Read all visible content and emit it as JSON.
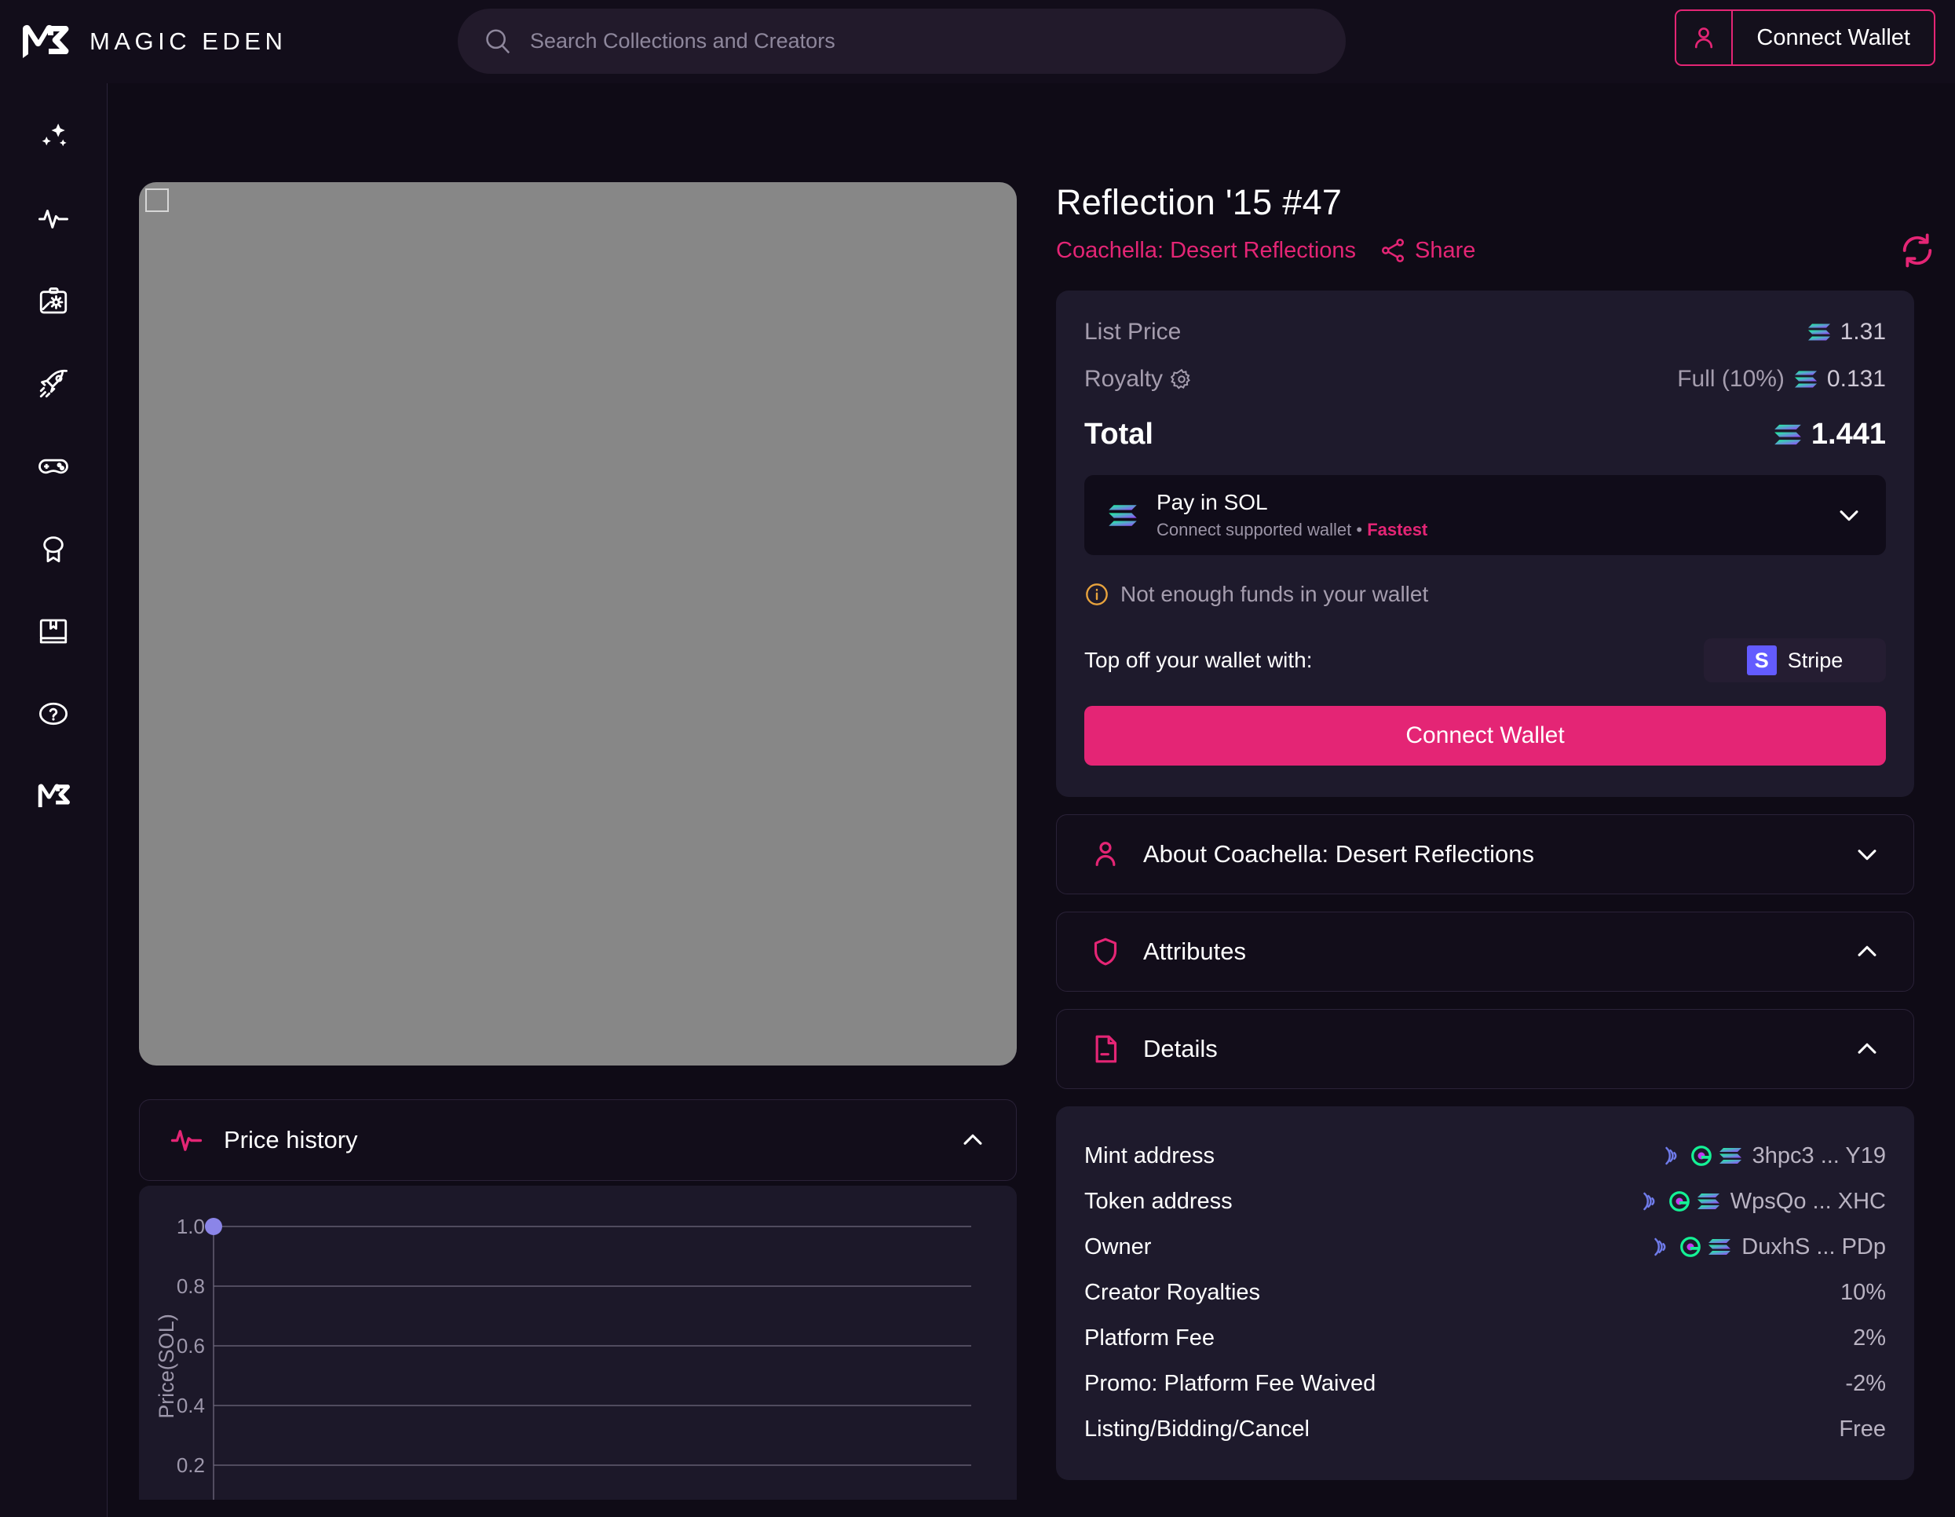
{
  "header": {
    "brand": "MAGIC EDEN",
    "brand_logo_icon": "magic-eden-logo",
    "search_placeholder": "Search Collections and Creators",
    "search_value": "",
    "search_icon": "search-icon",
    "connect_wallet_label": "Connect Wallet",
    "connect_wallet_icon": "user-icon"
  },
  "sidebar": {
    "items": [
      {
        "name": "sidebar-item-discover",
        "icon": "sparkles-icon"
      },
      {
        "name": "sidebar-item-activity",
        "icon": "activity-pulse-icon"
      },
      {
        "name": "sidebar-item-launchpad",
        "icon": "clipboard-icon"
      },
      {
        "name": "sidebar-item-rocket",
        "icon": "rocket-icon"
      },
      {
        "name": "sidebar-item-games",
        "icon": "gamepad-icon"
      },
      {
        "name": "sidebar-item-rewards",
        "icon": "award-badge-icon"
      },
      {
        "name": "sidebar-item-learn",
        "icon": "bookmark-book-icon"
      },
      {
        "name": "sidebar-item-help",
        "icon": "help-circle-icon"
      },
      {
        "name": "sidebar-item-me",
        "icon": "magic-eden-mark-icon"
      }
    ]
  },
  "nft": {
    "title": "Reflection '15 #47",
    "collection": "Coachella: Desert Reflections",
    "share_label": "Share",
    "share_icon": "share-nodes-icon",
    "refresh_icon": "refresh-icon",
    "image_alt": "nft-artwork-placeholder"
  },
  "price": {
    "list_price_label": "List Price",
    "list_price_value": "1.31",
    "royalty_label": "Royalty",
    "royalty_gear_icon": "gear-icon",
    "royalty_note": "Full (10%)",
    "royalty_value": "0.131",
    "total_label": "Total",
    "total_value": "1.441",
    "currency_icon": "solana-icon"
  },
  "payment": {
    "method_title": "Pay in SOL",
    "method_sub_prefix": "Connect supported wallet",
    "method_sub_sep": "•",
    "method_sub_badge": "Fastest",
    "method_icon": "solana-icon",
    "chevron_icon": "chevron-down-icon",
    "warning_text": "Not enough funds in your wallet",
    "warning_icon": "info-circle-icon",
    "topoff_label": "Top off your wallet with:",
    "stripe_label": "Stripe",
    "stripe_mark": "S",
    "stripe_color": "#635bff",
    "connect_wallet_label": "Connect Wallet"
  },
  "accordions": [
    {
      "label": "About Coachella: Desert Reflections",
      "icon": "user-outline-icon",
      "state": "collapsed",
      "chevron": "chevron-down-icon",
      "name": "accordion-about"
    },
    {
      "label": "Attributes",
      "icon": "shield-icon",
      "state": "expanded",
      "chevron": "chevron-up-icon",
      "name": "accordion-attributes"
    },
    {
      "label": "Details",
      "icon": "document-icon",
      "state": "expanded",
      "chevron": "chevron-up-icon",
      "name": "accordion-details"
    }
  ],
  "details": {
    "rows": [
      {
        "label": "Mint address",
        "value": "3hpc3 ... Y19",
        "has_explorer_icons": true
      },
      {
        "label": "Token address",
        "value": "WpsQo ... XHC",
        "has_explorer_icons": true
      },
      {
        "label": "Owner",
        "value": "DuxhS ... PDp",
        "has_explorer_icons": true
      },
      {
        "label": "Creator Royalties",
        "value": "10%",
        "has_explorer_icons": false
      },
      {
        "label": "Platform Fee",
        "value": "2%",
        "has_explorer_icons": false
      },
      {
        "label": "Promo: Platform Fee Waived",
        "value": "-2%",
        "has_explorer_icons": false
      },
      {
        "label": "Listing/Bidding/Cancel",
        "value": "Free",
        "has_explorer_icons": false
      }
    ]
  },
  "price_history": {
    "title": "Price history",
    "icon": "activity-pulse-icon",
    "state": "expanded",
    "chevron": "chevron-up-icon"
  },
  "chart_data": {
    "type": "scatter",
    "title": "Price history",
    "xlabel": "",
    "ylabel": "Price(SOL)",
    "yticks": [
      "1.0",
      "0.8",
      "0.6",
      "0.4",
      "0.2"
    ],
    "ytick_values": [
      1.0,
      0.8,
      0.6,
      0.4,
      0.2
    ],
    "ylim": [
      0.1,
      1.05
    ],
    "x": [
      0
    ],
    "values": [
      1.0
    ],
    "series": [
      {
        "name": "Price(SOL)",
        "values": [
          1.0
        ],
        "color": "#8b85e8"
      }
    ],
    "grid": true,
    "legend": "none"
  },
  "colors": {
    "accent": "#e42575",
    "page_bg": "#0f0b16",
    "card_bg": "#1e1a2c",
    "panel_bg": "#120d1a",
    "chart_point": "#8b85e8"
  }
}
